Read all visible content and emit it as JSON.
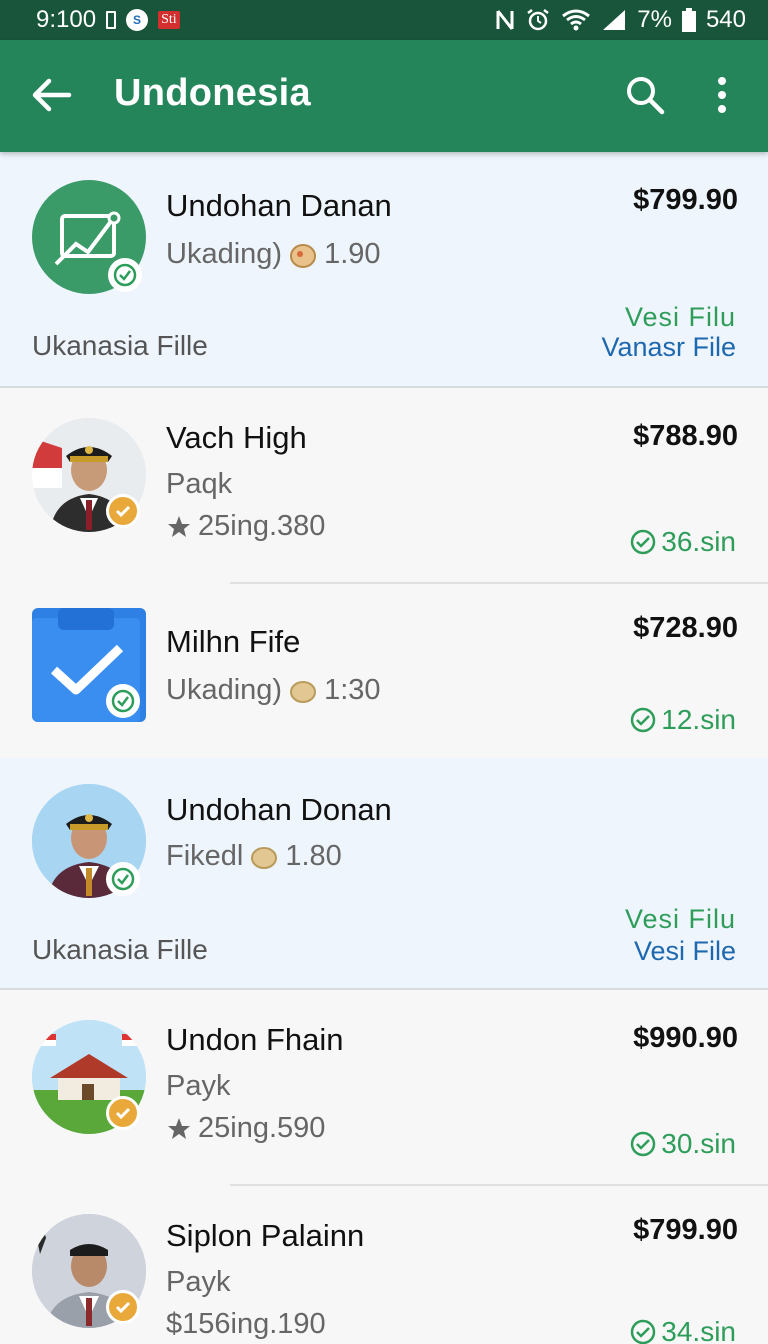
{
  "status_bar": {
    "time": "9:100",
    "app_badge": "S",
    "red_badge": "Sti",
    "battery": "7%",
    "signal_extra": "540"
  },
  "app_bar": {
    "title": "Undonesia"
  },
  "items": [
    {
      "name": "Undohan Danan",
      "sub_text": "Ukading)",
      "sub_icon": "food-icon",
      "sub_value": "1.90",
      "price": "$799.90",
      "file_status": "Vesi Filu",
      "file_link": "Vanasr File",
      "footer": "Ukanasia Fille",
      "avatar_icon": "chart-icon",
      "verified_color": "#2e9d5a"
    },
    {
      "name": "Vach High",
      "sub_text": "Paqk",
      "sub_rating": "25ing.380",
      "price": "$788.90",
      "status": "36.sin",
      "avatar_icon": "officer-photo",
      "verified_color": "#e8a93a"
    },
    {
      "name": "Milhn Fife",
      "sub_text": "Ukading)",
      "sub_icon": "food-icon",
      "sub_value": "1:30",
      "price": "$728.90",
      "status": "12.sin",
      "avatar_icon": "clipboard-check-icon",
      "verified_color": "#2e9d5a"
    },
    {
      "name": "Undohan Donan",
      "sub_text": "Fikedl",
      "sub_icon": "food-icon",
      "sub_value": "1.80",
      "file_status": "Vesi Filu",
      "file_link": "Vesi File",
      "footer": "Ukanasia Fille",
      "avatar_icon": "officer-photo",
      "verified_color": "#2e9d5a"
    },
    {
      "name": "Undon Fhain",
      "sub_text": "Payk",
      "sub_rating": "25ing.590",
      "price": "$990.90",
      "status": "30.sin",
      "avatar_icon": "house-photo",
      "verified_color": "#e8a93a"
    },
    {
      "name": "Siplon Palainn",
      "sub_text": "Payk",
      "sub_rating": "$156ing.190",
      "price": "$799.90",
      "status": "34.sin",
      "avatar_icon": "man-photo",
      "verified_color": "#e8a93a"
    }
  ],
  "colors": {
    "app_bar": "#25855a",
    "status_bar": "#18553a",
    "accent_green": "#2e9d5a",
    "link_blue": "#1e68b0"
  }
}
